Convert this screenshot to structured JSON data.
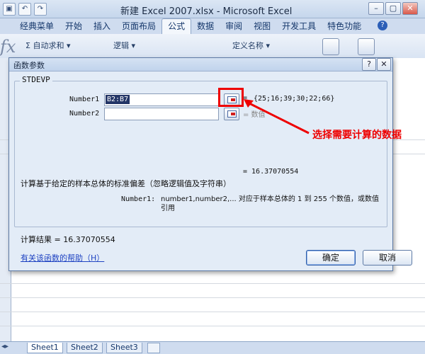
{
  "window": {
    "title": "新建 Excel 2007.xlsx - Microsoft Excel",
    "controls": [
      "minimize",
      "restore",
      "close"
    ]
  },
  "ribbon": {
    "tabs": [
      {
        "label": "经典菜单",
        "active": false
      },
      {
        "label": "开始",
        "active": false
      },
      {
        "label": "插入",
        "active": false
      },
      {
        "label": "页面布局",
        "active": false
      },
      {
        "label": "公式",
        "active": true
      },
      {
        "label": "数据",
        "active": false
      },
      {
        "label": "审阅",
        "active": false
      },
      {
        "label": "视图",
        "active": false
      },
      {
        "label": "开发工具",
        "active": false
      },
      {
        "label": "特色功能",
        "active": false
      }
    ],
    "autosum_label": "Σ 自动求和 ▾",
    "logic_label": "逻辑 ▾",
    "define_name_label": "定义名称 ▾",
    "fx_label": "fx",
    "help_icon": "help-icon"
  },
  "sheets": {
    "tabs": [
      "Sheet1",
      "Sheet2",
      "Sheet3"
    ],
    "active": "Sheet1"
  },
  "dialog": {
    "title": "函数参数",
    "function_name": "STDEVP",
    "args": [
      {
        "label": "Number1",
        "value": "B2:B7",
        "result": "{25;16;39;30;22;66}"
      },
      {
        "label": "Number2",
        "value": "",
        "result": "= 数值"
      }
    ],
    "equals_result": "= 16.37070554",
    "description": "计算基于给定的样本总体的标准偏差（忽略逻辑值及字符串）",
    "arg_help_label": "Number1:",
    "arg_help_text": "number1,number2,... 对应于样本总体的 1 到 255 个数值，或数值引用",
    "calc_result": "计算结果 = 16.37070554",
    "help_link": "有关该函数的帮助（H）",
    "ok_label": "确定",
    "cancel_label": "取消"
  },
  "annotation": {
    "text": "选择需要计算的数据",
    "color": "#e00000"
  }
}
